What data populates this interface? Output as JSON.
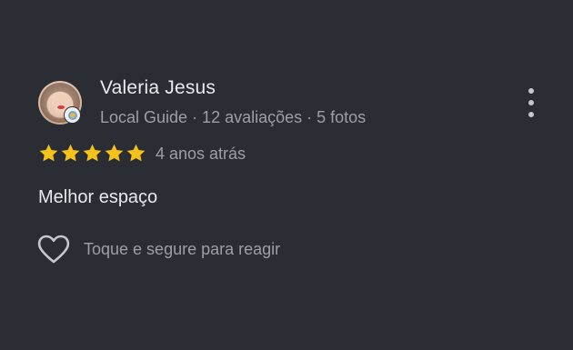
{
  "review": {
    "author_name": "Valeria Jesus",
    "author_meta": "Local Guide · 12 avaliações · 5 fotos",
    "rating": 5,
    "rating_max": 5,
    "time_ago": "4 anos atrás",
    "text": "Melhor espaço",
    "react_label": "Toque e segure para reagir"
  },
  "icons": {
    "more": "more-vert-icon",
    "heart": "heart-outline-icon",
    "star": "star-filled-icon",
    "badge": "local-guide-badge-icon"
  },
  "colors": {
    "background": "#2a2d34",
    "star": "#f5c21b",
    "primary_text": "#e8eaed",
    "secondary_text": "#9aa0a6"
  }
}
